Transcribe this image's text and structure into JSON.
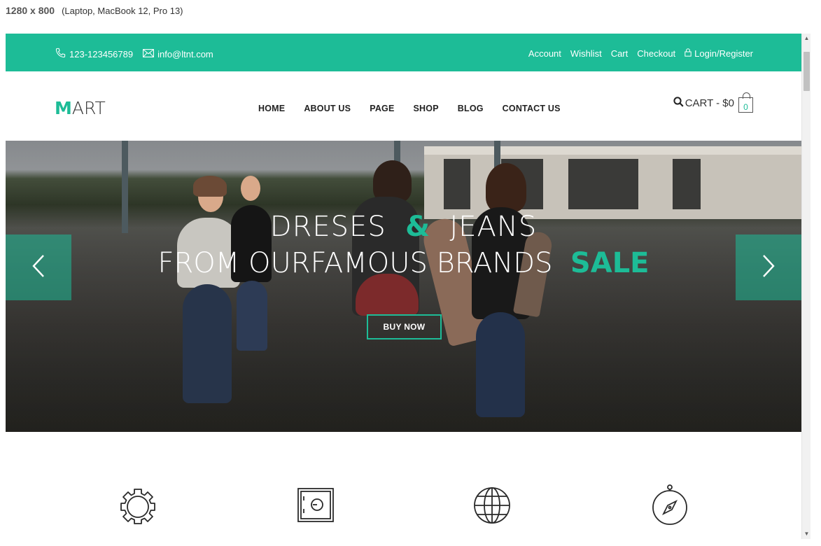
{
  "frame": {
    "dimensions": "1280 x 800",
    "device": "(Laptop, MacBook 12, Pro 13)"
  },
  "topbar": {
    "phone": "123-123456789",
    "email": "info@ltnt.com",
    "links": [
      "Account",
      "Wishlist",
      "Cart",
      "Checkout"
    ],
    "login": "Login/Register"
  },
  "header": {
    "logo_accent": "M",
    "logo_rest": "ART",
    "nav": [
      "HOME",
      "ABOUT US",
      "PAGE",
      "SHOP",
      "BLOG",
      "CONTACT US"
    ],
    "cart_label": "CART - $0",
    "cart_count": "0"
  },
  "hero": {
    "line1_a": "DRESES",
    "line1_amp": "&",
    "line1_b": "JEANS",
    "line2_a": "FROM OURFAMOUS BRANDS",
    "line2_accent": "SALE",
    "button": "BUY NOW"
  },
  "features": {
    "icons": [
      "gear-icon",
      "safe-icon",
      "globe-icon",
      "compass-icon"
    ]
  },
  "colors": {
    "accent": "#1dbc97",
    "text_dark": "#222222"
  }
}
